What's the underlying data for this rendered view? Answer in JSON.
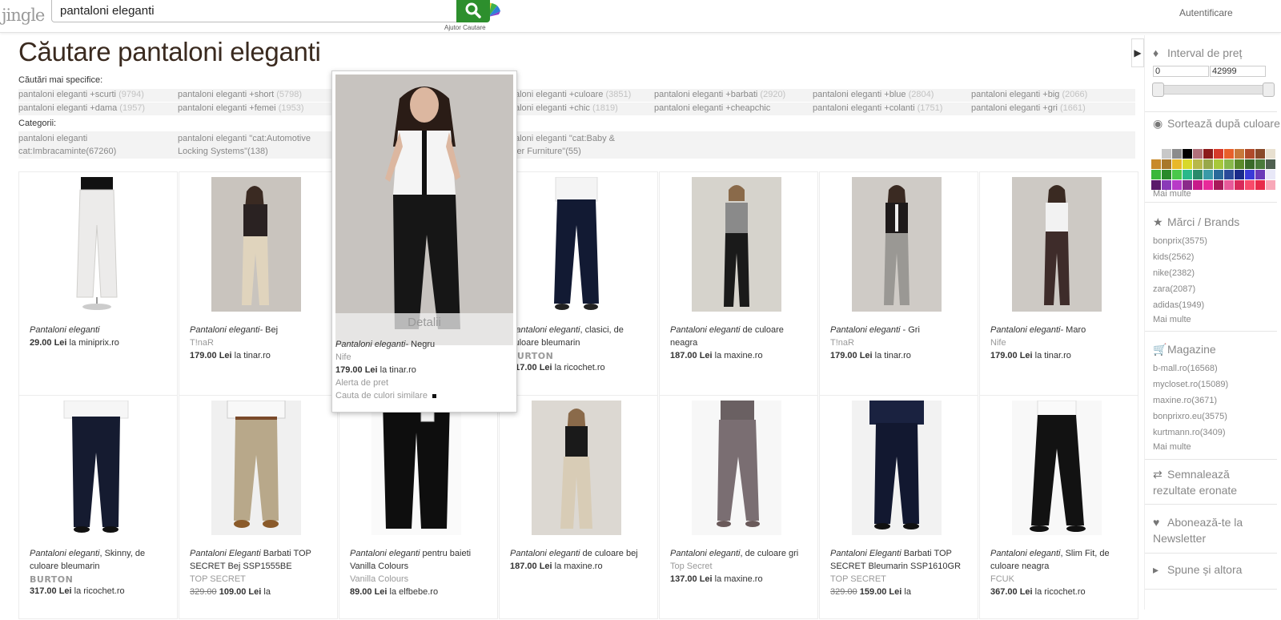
{
  "header": {
    "logo": "jingle",
    "search_value": "pantaloni eleganti",
    "help_label": "Ajutor Cautare",
    "login_label": "Autentificare"
  },
  "page": {
    "title": "Căutare pantaloni eleganti",
    "specific_label": "Căutări mai specifice:",
    "categories_label": "Categorii:"
  },
  "suggestions_row1": [
    {
      "text": "pantaloni eleganti +scurti",
      "count": "(9794)"
    },
    {
      "text": "pantaloni eleganti +short",
      "count": "(5798)"
    },
    {
      "text": "aloni eleganti +culoare",
      "count": "(3851)"
    },
    {
      "text": "pantaloni eleganti +barbati",
      "count": "(2920)"
    },
    {
      "text": "pantaloni eleganti +blue",
      "count": "(2804)"
    },
    {
      "text": "pantaloni eleganti +big",
      "count": "(2066)"
    }
  ],
  "suggestions_row2": [
    {
      "text": "pantaloni eleganti +dama",
      "count": "(1957)"
    },
    {
      "text": "pantaloni eleganti +femei",
      "count": "(1953)"
    },
    {
      "text": "aloni eleganti +chic",
      "count": "(1819)"
    },
    {
      "text": "pantaloni eleganti +cheapchic",
      "count": ""
    },
    {
      "text": "pantaloni eleganti +colanti",
      "count": "(1751)"
    },
    {
      "text": "pantaloni eleganti +gri",
      "count": "(1661)"
    }
  ],
  "categories": [
    {
      "line1": "pantaloni eleganti",
      "line2": "cat:Imbracaminte(67260)"
    },
    {
      "line1": "pantaloni eleganti \"cat:Automotive",
      "line2": "Locking Systems\"(138)"
    },
    {
      "line1": "aloni eleganti \"cat:Baby &",
      "line2": "ler Furniture\"(55)"
    }
  ],
  "products_row1": [
    {
      "title": "Pantaloni eleganti",
      "rest": "",
      "brand": "",
      "old_price": "",
      "price": "29.00 Lei",
      "shop": "la miniprix.ro"
    },
    {
      "title": "Pantaloni eleganti-",
      "rest": " Bej",
      "brand": "T!naR",
      "old_price": "",
      "price": "179.00 Lei",
      "shop": "la tinar.ro"
    },
    {
      "title": "",
      "rest": "",
      "brand": "",
      "old_price": "",
      "price": "",
      "shop": ""
    },
    {
      "title": "Pantaloni eleganti",
      "rest": ", clasici, de culoare bleumarin",
      "brand": "BURTON",
      "old_price": "",
      "price": "317.00 Lei",
      "shop": "la ricochet.ro"
    },
    {
      "title": "Pantaloni eleganti",
      "rest": " de culoare neagra",
      "brand": "",
      "old_price": "",
      "price": "187.00 Lei",
      "shop": "la maxine.ro"
    },
    {
      "title": "Pantaloni eleganti",
      "rest": " - Gri",
      "brand": "T!naR",
      "old_price": "",
      "price": "179.00 Lei",
      "shop": "la tinar.ro"
    },
    {
      "title": "Pantaloni eleganti-",
      "rest": " Maro",
      "brand": "Nife",
      "old_price": "",
      "price": "179.00 Lei",
      "shop": "la tinar.ro"
    }
  ],
  "products_row2": [
    {
      "title": "Pantaloni eleganti",
      "rest": ", Skinny, de culoare bleumarin",
      "brand": "BURTON",
      "old_price": "",
      "price": "317.00 Lei",
      "shop": "la ricochet.ro"
    },
    {
      "title": "Pantaloni Eleganti",
      "rest": " Barbati TOP SECRET Bej SSP1555BE",
      "brand": "TOP SECRET",
      "old_price": "329.00",
      "price": "109.00 Lei",
      "shop": "la"
    },
    {
      "title": "Pantaloni eleganti",
      "rest": " pentru baieti Vanilla Colours",
      "brand": "Vanilla Colours",
      "old_price": "",
      "price": "89.00 Lei",
      "shop": "la elfbebe.ro"
    },
    {
      "title": "Pantaloni eleganti",
      "rest": " de culoare bej",
      "brand": "",
      "old_price": "",
      "price": "187.00 Lei",
      "shop": "la maxine.ro"
    },
    {
      "title": "Pantaloni eleganti",
      "rest": ", de culoare gri",
      "brand": "Top Secret",
      "old_price": "",
      "price": "137.00 Lei",
      "shop": "la maxine.ro"
    },
    {
      "title": "Pantaloni Eleganti",
      "rest": " Barbati TOP SECRET Bleumarin SSP1610GR",
      "brand": "TOP SECRET",
      "old_price": "329.00",
      "price": "159.00 Lei",
      "shop": "la"
    },
    {
      "title": "Pantaloni eleganti",
      "rest": ", Slim Fit, de culoare neagra",
      "brand": "FCUK",
      "old_price": "",
      "price": "367.00 Lei",
      "shop": "la ricochet.ro"
    }
  ],
  "popup": {
    "details": "Detalii",
    "title": "Pantaloni eleganti-",
    "rest": " Negru",
    "brand": "Nife",
    "price": "179.00 Lei",
    "shop": "la tinar.ro",
    "alert": "Alerta de pret",
    "similar": "Cauta de culori similare"
  },
  "sidebar": {
    "price_label": "Interval de preț",
    "price_min": "0",
    "price_max": "42999",
    "color_label": "Sortează după culoare",
    "color_more": "Mai multe",
    "brands_label": "Mărci / Brands",
    "brands": [
      "bonprix(3575)",
      "kids(2562)",
      "nike(2382)",
      "zara(2087)",
      "adidas(1949)"
    ],
    "brands_more": "Mai multe",
    "shops_label": "Magazine",
    "shops": [
      "b-mall.ro(16568)",
      "mycloset.ro(15089)",
      "maxine.ro(3671)",
      "bonprixro.eu(3575)",
      "kurtmann.ro(3409)"
    ],
    "shops_more": "Mai multe",
    "report_label": "Semnalează rezultate eronate",
    "newsletter_label": "Abonează-te la Newsletter",
    "share_label": "Spune și altora"
  },
  "swatch_colors": [
    "#ffffff",
    "#c8c8c8",
    "#8c8c8c",
    "#000000",
    "#b0707a",
    "#8b1a1a",
    "#d63a2a",
    "#e8602a",
    "#c8783a",
    "#b04a2a",
    "#8a4a2a",
    "#e8e0d0",
    "#c88a2a",
    "#a8782a",
    "#e8b82a",
    "#d8d82a",
    "#b8b84a",
    "#98a84a",
    "#a8c83a",
    "#88b84a",
    "#5a8a2a",
    "#3a6a2a",
    "#4a7a3a",
    "#506050",
    "#3ab83a",
    "#2a8a2a",
    "#4ac84a",
    "#2ab88a",
    "#2a8a6a",
    "#3a9aa8",
    "#2a6a9a",
    "#2a4a9a",
    "#1a2a8a",
    "#3a3ad8",
    "#6a3ab8",
    "#e8e8f8",
    "#5a1a6a",
    "#8a3ab8",
    "#b83ac8",
    "#8a2a8a",
    "#c81a8a",
    "#e82a9a",
    "#a81a5a",
    "#e85a9a",
    "#d82a5a",
    "#f84a6a",
    "#e82a4a",
    "#f8a8b8"
  ]
}
